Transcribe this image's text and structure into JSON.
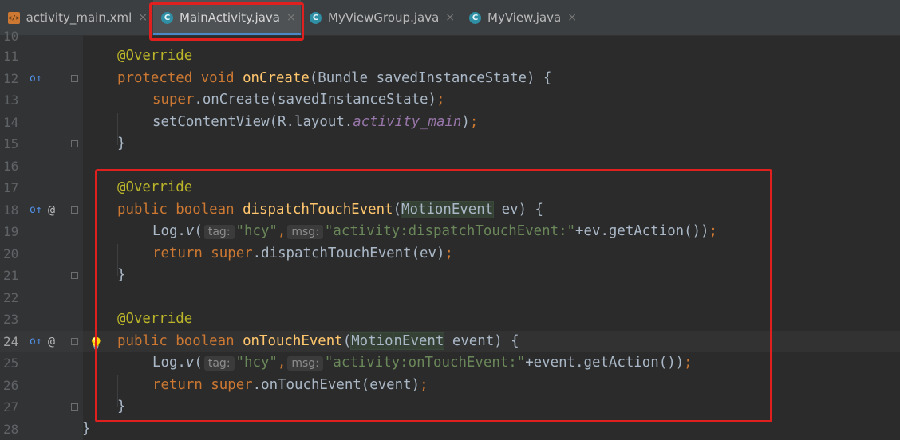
{
  "tabs": [
    {
      "name": "activity_main.xml",
      "icon": "xml-file-icon",
      "active": false
    },
    {
      "name": "MainActivity.java",
      "icon": "java-class-icon",
      "active": true
    },
    {
      "name": "MyViewGroup.java",
      "icon": "java-class-icon",
      "active": false
    },
    {
      "name": "MyView.java",
      "icon": "java-class-icon",
      "active": false
    }
  ],
  "close_glyph": "×",
  "editor": {
    "line_numbers": [
      "10",
      "11",
      "12",
      "13",
      "14",
      "15",
      "16",
      "17",
      "18",
      "19",
      "20",
      "21",
      "22",
      "23",
      "24",
      "25",
      "26",
      "27",
      "28"
    ],
    "current_line": "24",
    "hints": {
      "tag": "tag:",
      "msg": "msg:"
    },
    "code": {
      "l11_annotation": "@Override",
      "l12_kw": "protected void ",
      "l12_fn": "onCreate",
      "l12_rest": "(Bundle savedInstanceState) {",
      "l13_super": "super",
      "l13_rest": ".onCreate(savedInstanceState)",
      "l13_semi": ";",
      "l14_call": "setContentView(R.layout.",
      "l14_field": "activity_main",
      "l14_close": ")",
      "l14_semi": ";",
      "l15_brace": "}",
      "l17_annotation": "@Override",
      "l18_kw": "public boolean ",
      "l18_fn": "dispatchTouchEvent",
      "l18_open": "(",
      "l18_type": "MotionEvent",
      "l18_rest": " ev) {",
      "l19_log": "Log.",
      "l19_v": "v",
      "l19_open": "(",
      "l19_tag": "\"hcy\"",
      "l19_comma": ",",
      "l19_msg": "\"activity:dispatchTouchEvent:\"",
      "l19_rest": "+ev.getAction())",
      "l19_semi": ";",
      "l20_return": "return ",
      "l20_super": "super",
      "l20_rest": ".dispatchTouchEvent(ev)",
      "l20_semi": ";",
      "l21_brace": "}",
      "l23_annotation": "@Override",
      "l24_kw": "public boolean ",
      "l24_fn": "onTouchEvent",
      "l24_open": "(",
      "l24_type_a": "Motio",
      "l24_type_b": "nEvent",
      "l24_rest": " event) {",
      "l25_log": "Log.",
      "l25_v": "v",
      "l25_open": "(",
      "l25_tag": "\"hcy\"",
      "l25_comma": ",",
      "l25_msg": "\"activity:onTouchEvent:\"",
      "l25_rest": "+event.getAction())",
      "l25_semi": ";",
      "l26_return": "return ",
      "l26_super": "super",
      "l26_rest": ".onTouchEvent(event)",
      "l26_semi": ";",
      "l27_brace": "}",
      "l28_brace": "}"
    },
    "gutter_marks": {
      "override": "o↑",
      "at": "@"
    }
  },
  "colors": {
    "highlight_box": "#e01f1f",
    "accent_tab": "#4a88c7",
    "keyword": "#cc7832",
    "function": "#ffc66d",
    "string": "#6a8759",
    "annotation": "#bbb529"
  }
}
